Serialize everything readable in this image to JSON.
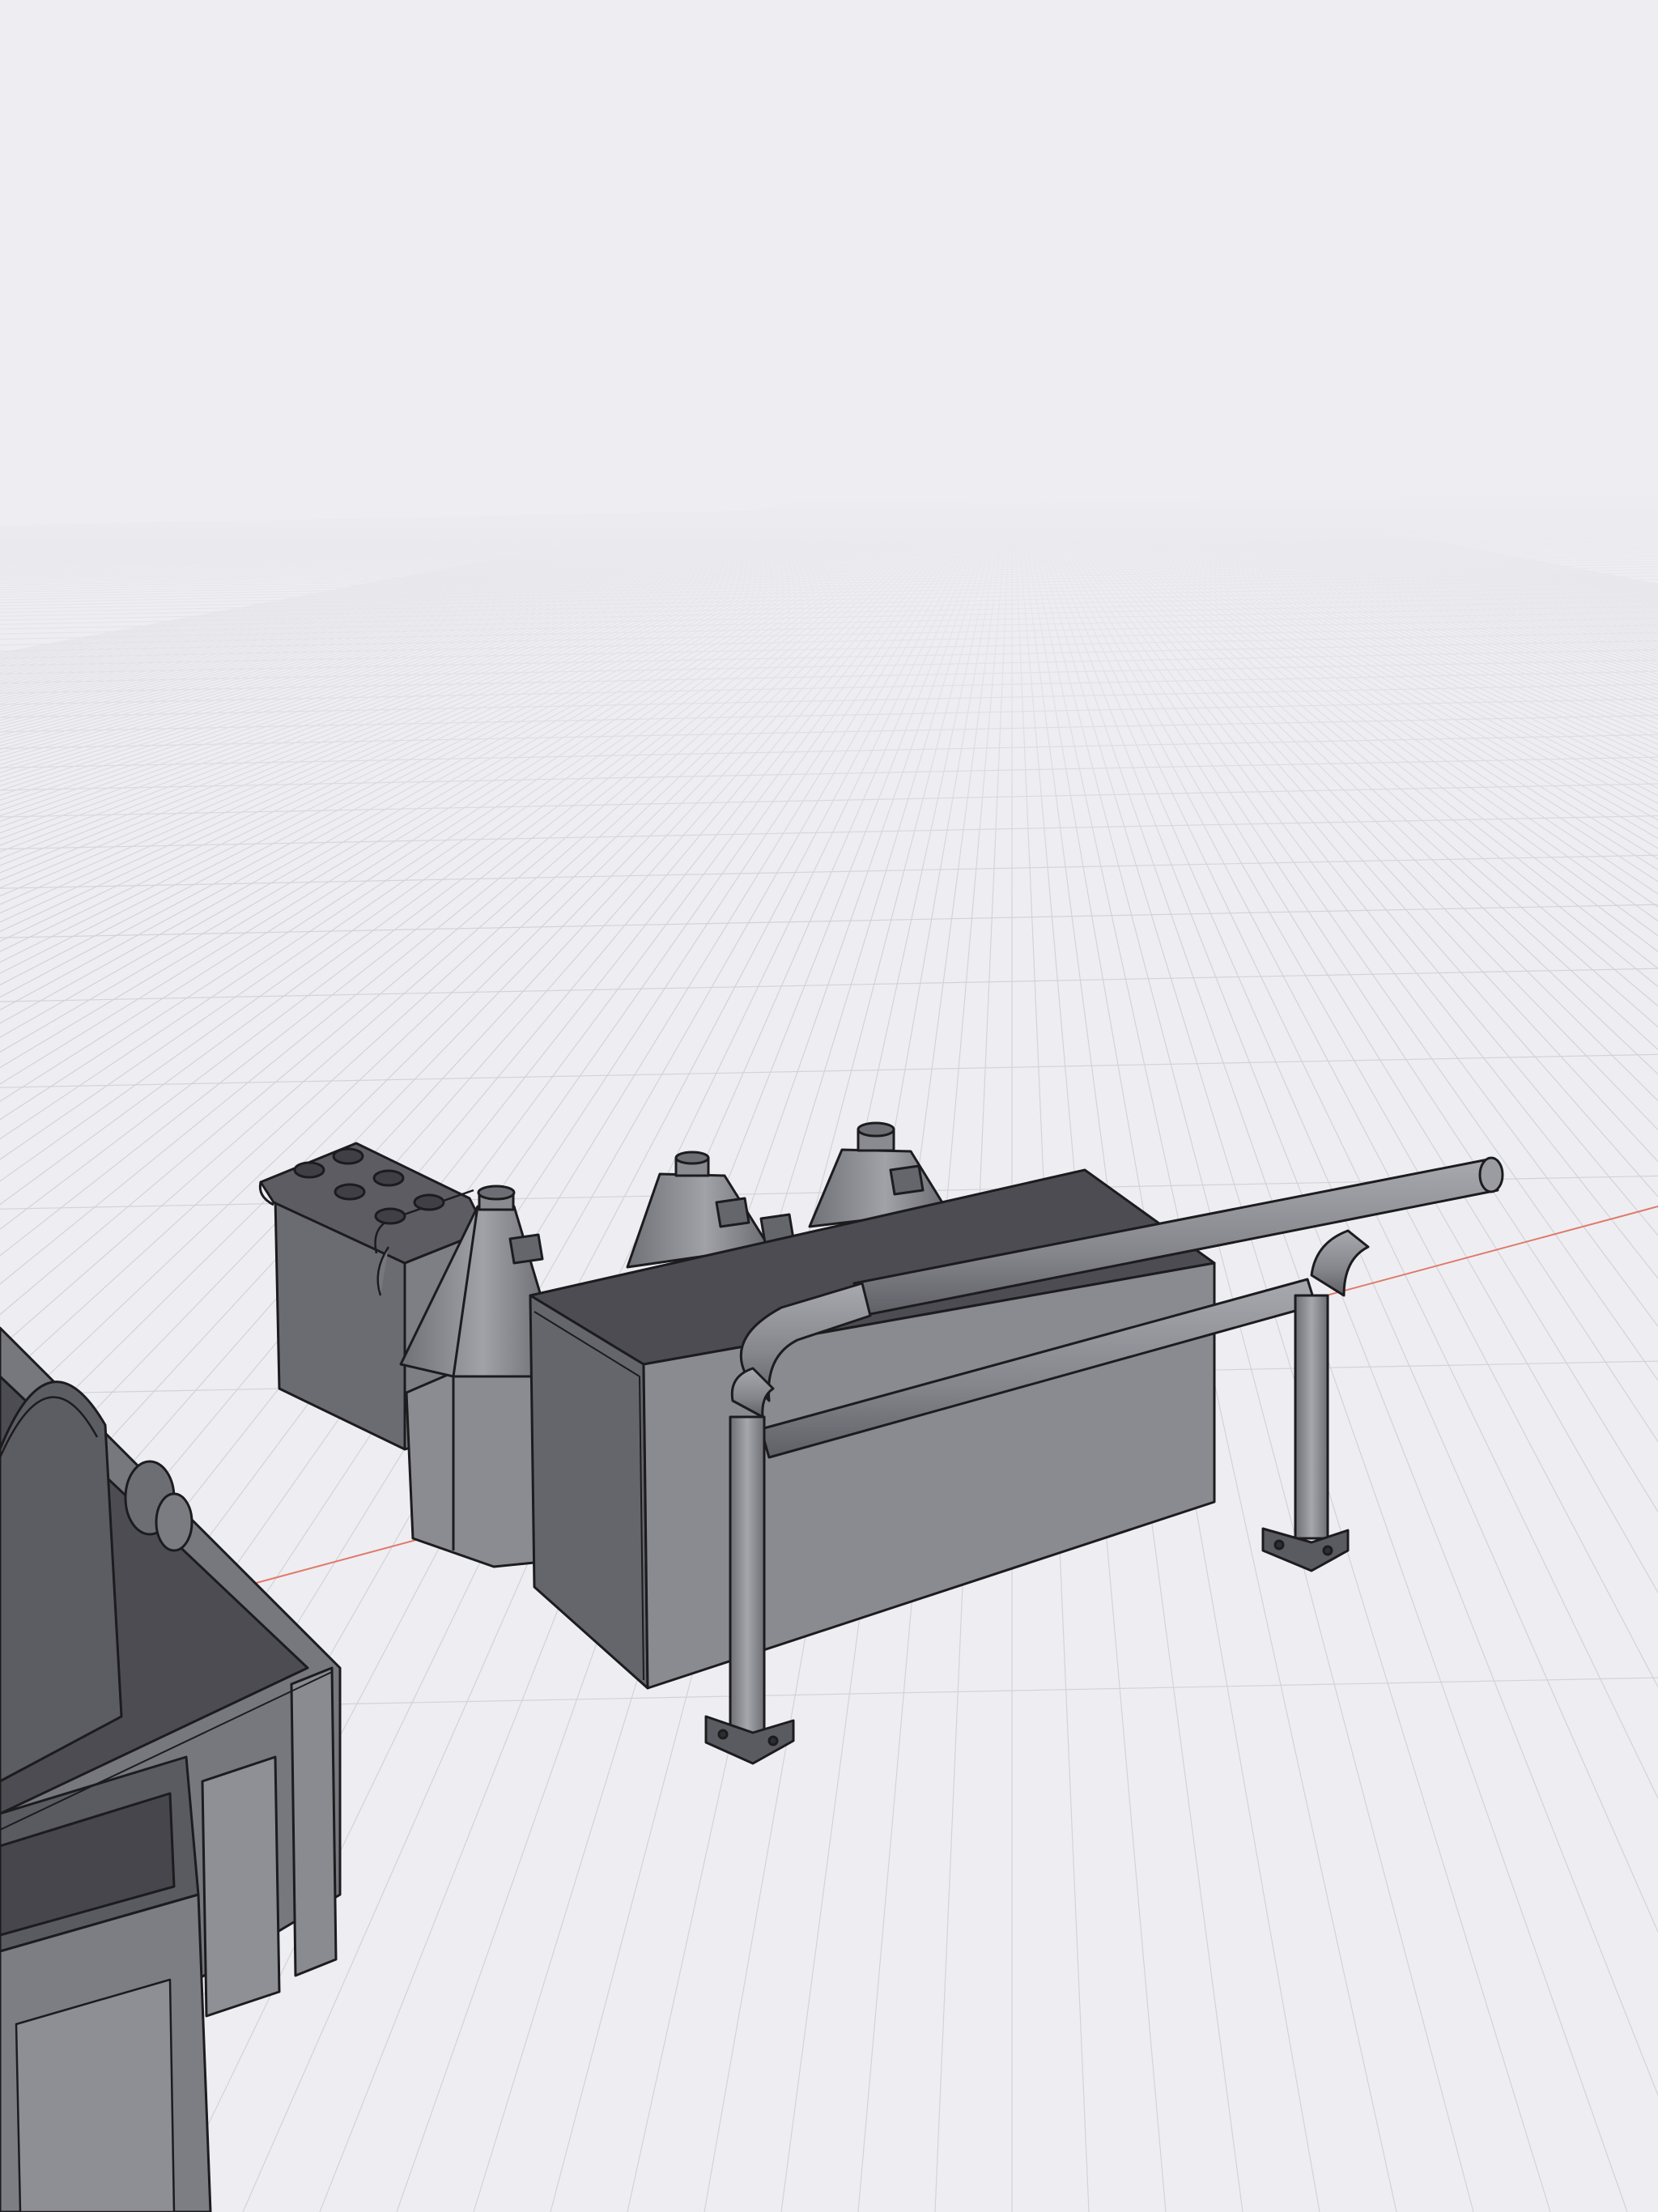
{
  "app": {
    "view": "3d-perspective-viewport",
    "background_color": "#eeeef2",
    "grid_line_color": "#d6d6dc",
    "axis_color": "#e07a6a"
  },
  "scene": {
    "objects": [
      "cabinet-with-six-round-ports",
      "conical-hopper-front",
      "conical-hopper-middle",
      "conical-hopper-back",
      "rectangular-box-enclosure",
      "pipe-railing-frame",
      "equipment-trailer"
    ],
    "model_fill_light": "#8f8f96",
    "model_fill_dark": "#4a4a50",
    "model_fill_top": "#5d5d63",
    "edge_color": "#1c1c1f"
  }
}
